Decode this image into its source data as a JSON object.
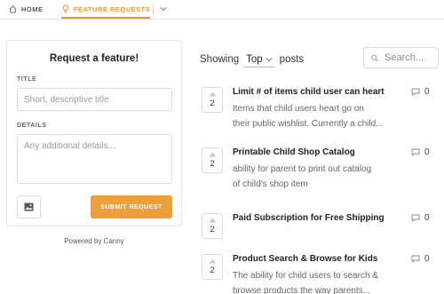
{
  "nav": {
    "home_label": "HOME",
    "features_label": "FEATURE REQUESTS",
    "accent_color": "#e69a31"
  },
  "request_form": {
    "heading": "Request a feature!",
    "title_label": "TITLE",
    "title_placeholder": "Short, descriptive title",
    "details_label": "DETAILS",
    "details_placeholder": "Any additional details...",
    "attach_icon": "image-icon",
    "submit_label": "SUBMIT REQUEST"
  },
  "powered_by": "Powered by Canny",
  "sort": {
    "prefix": "Showing",
    "selected": "Top",
    "suffix": "posts"
  },
  "search": {
    "placeholder": "Search..."
  },
  "posts": [
    {
      "title": "Limit # of items child user can heart",
      "body_line1": "Items that child users heart go on",
      "body_line2": "their public wishlist. Currently a child...",
      "votes": "2",
      "comments": "0"
    },
    {
      "title": "Printable Child Shop Catalog",
      "body_line1": "ability for parent to print out catalog",
      "body_line2": "of child's shop item",
      "votes": "2",
      "comments": "0"
    },
    {
      "title": "Paid Subscription for Free Shipping",
      "body_line1": "",
      "body_line2": "",
      "votes": "2",
      "comments": "0"
    },
    {
      "title": "Product Search & Browse for Kids",
      "body_line1": "The ability for child users to search &",
      "body_line2": "browse products the way parents...",
      "votes": "2",
      "comments": "0"
    }
  ]
}
